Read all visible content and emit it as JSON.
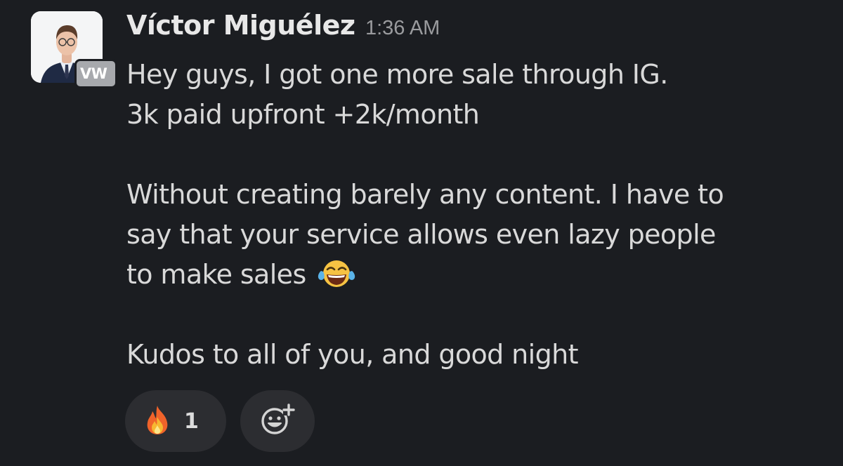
{
  "message": {
    "sender": "Víctor Miguélez",
    "timestamp": "1:36 AM",
    "workspace_badge": "VW",
    "lines": [
      "Hey guys, I got one more sale through IG.",
      "3k paid upfront +2k/month",
      "",
      "Without creating barely any content. I have to",
      "say that your service allows even lazy people",
      "to make sales",
      "",
      "Kudos to all of you, and good night"
    ],
    "inline_emoji": "joy-emoji"
  },
  "reactions": [
    {
      "emoji": "fire-emoji",
      "count": "1"
    }
  ],
  "add_reaction_icon": "add-emoji-icon",
  "colors": {
    "background": "#1b1d21",
    "text": "#d9d9d9",
    "timestamp": "#9a9b9e",
    "pill": "#2c2d31"
  }
}
